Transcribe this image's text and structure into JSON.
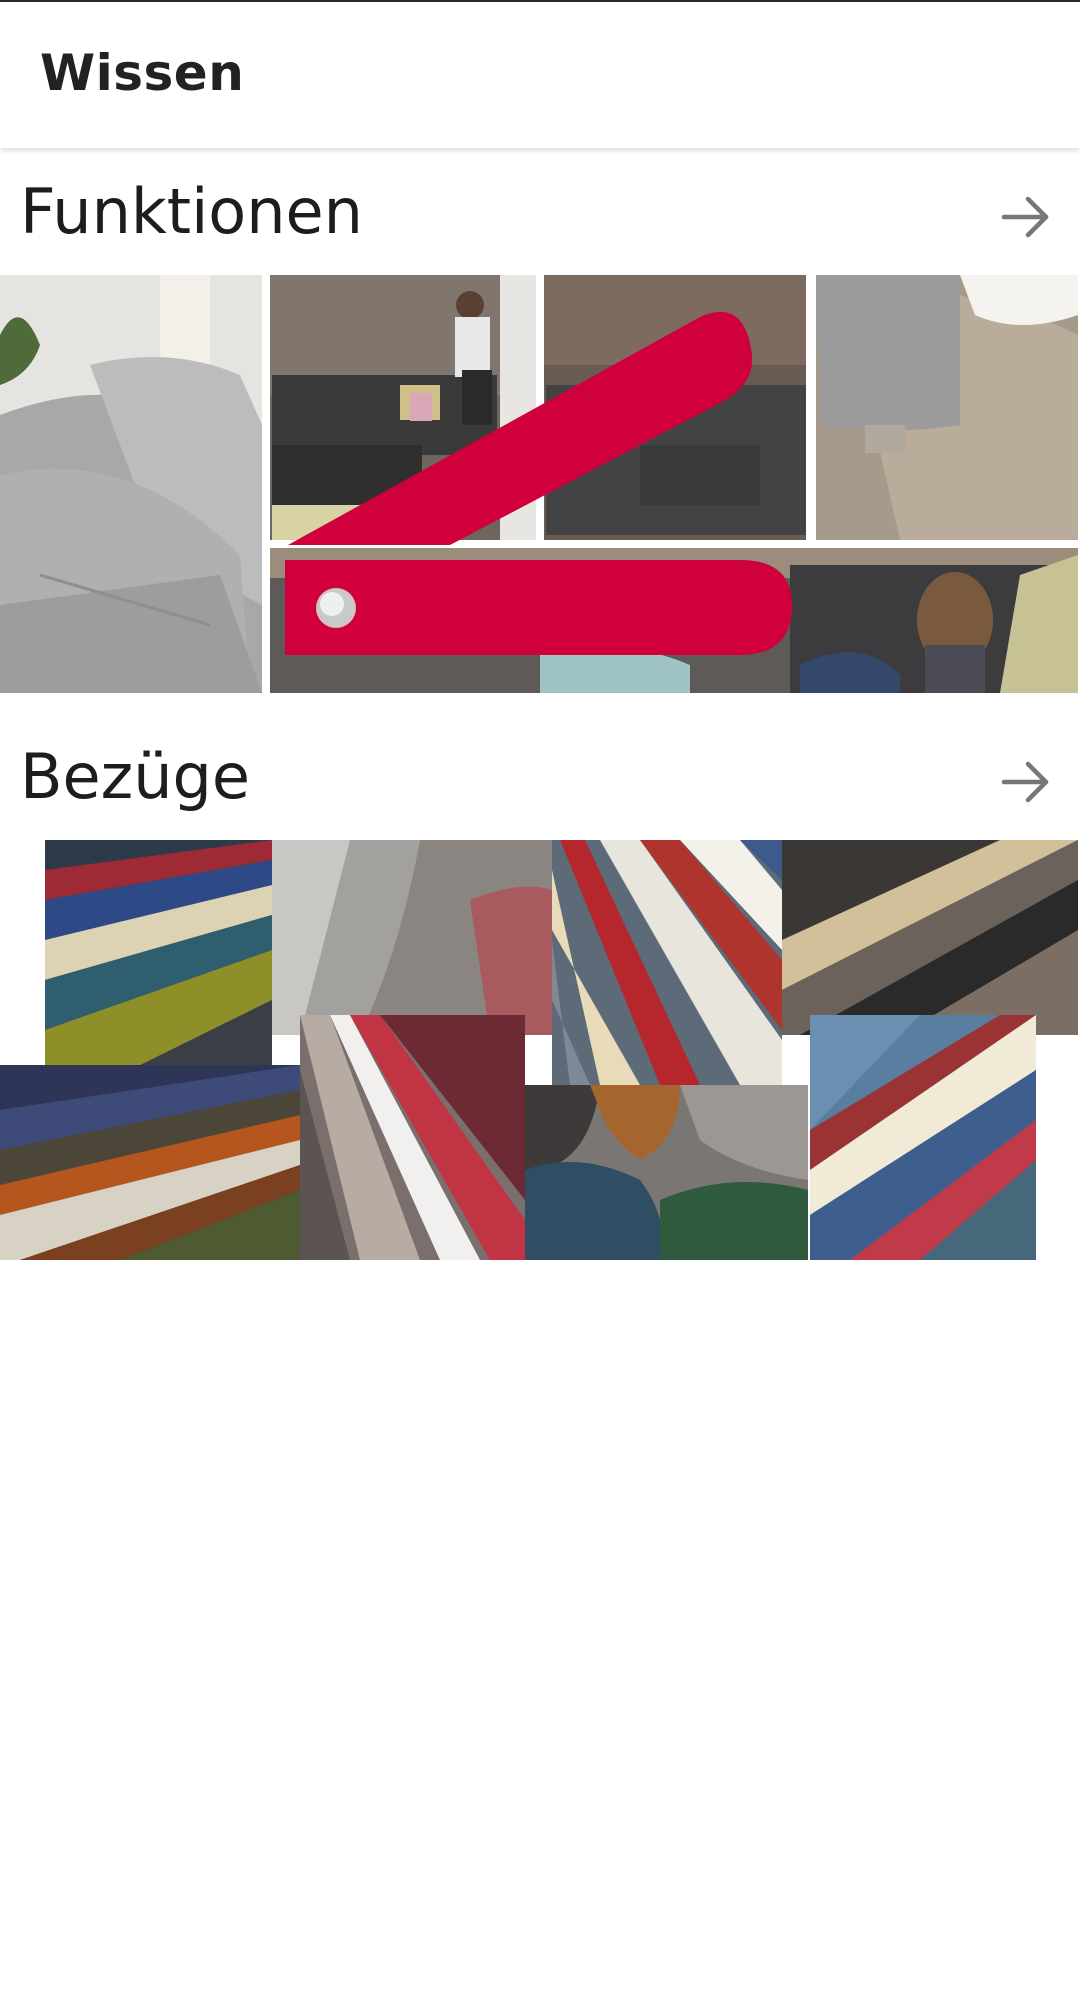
{
  "header": {
    "title": "Wissen"
  },
  "sections": [
    {
      "title": "Funktionen",
      "arrow_icon": "arrow-right-icon"
    },
    {
      "title": "Bezüge",
      "arrow_icon": "arrow-right-icon"
    }
  ],
  "colors": {
    "brand_red": "#d0003c",
    "text": "#1d1d1d",
    "icon_gray": "#777777"
  }
}
